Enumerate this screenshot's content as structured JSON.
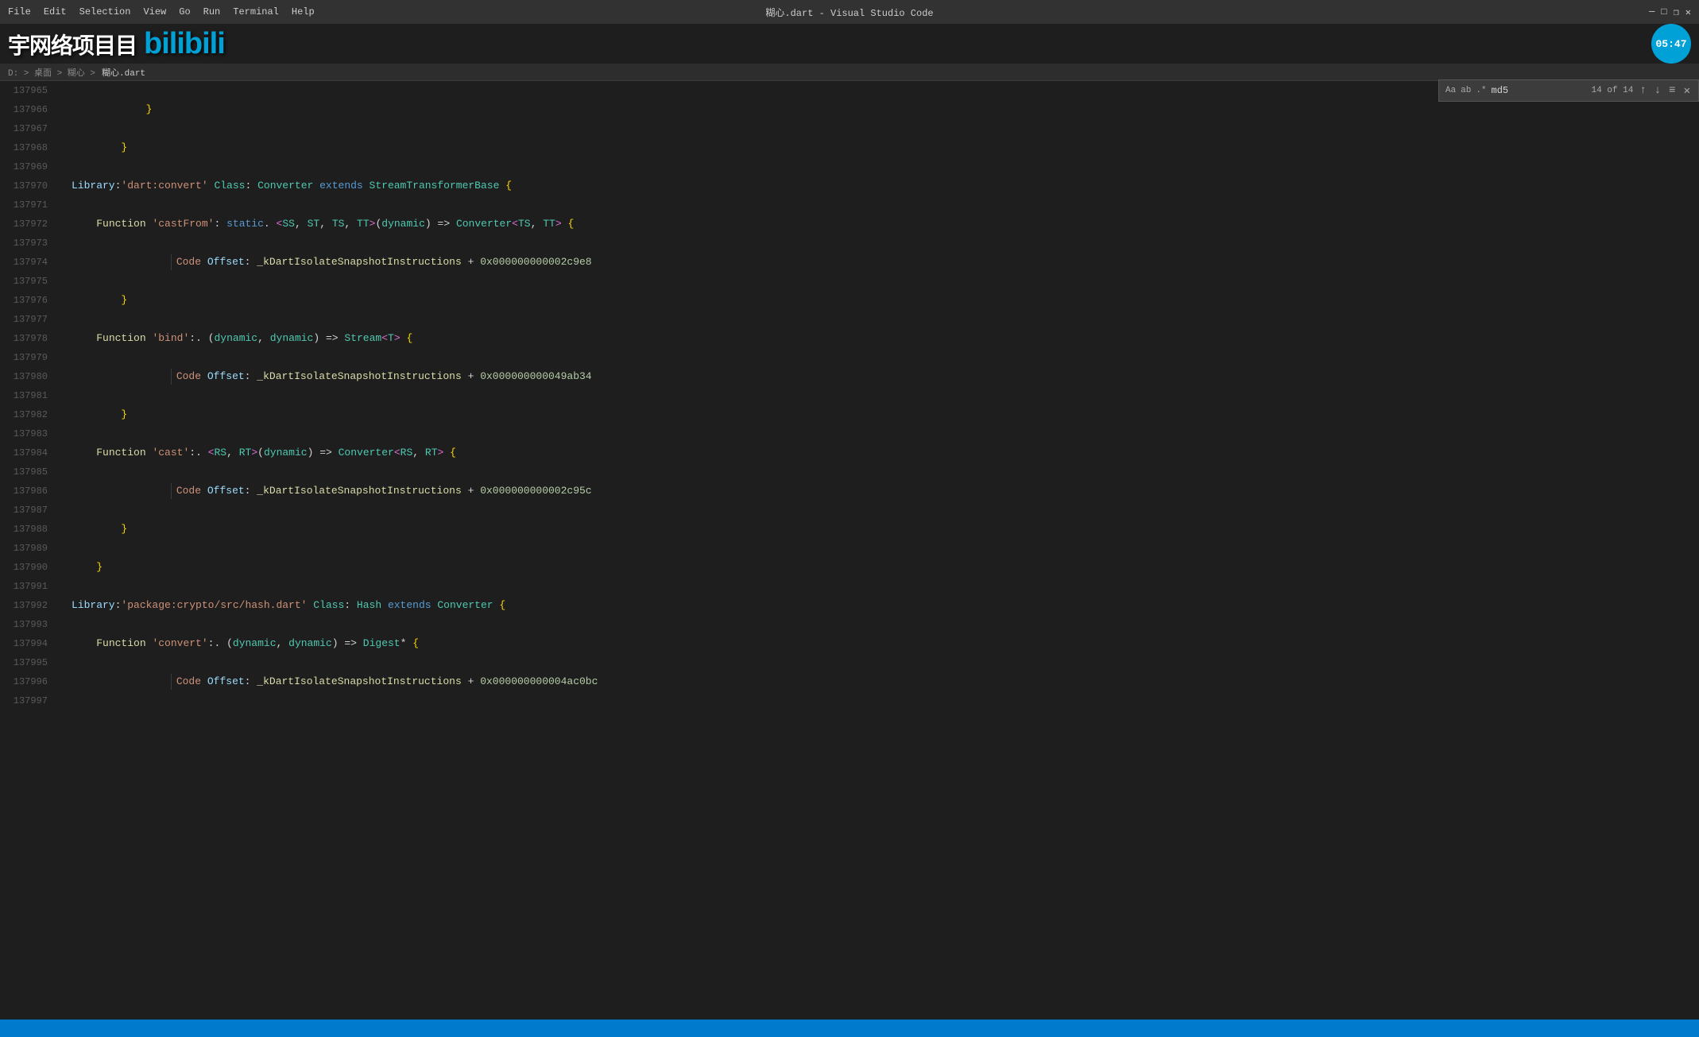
{
  "titlebar": {
    "menu": [
      "File",
      "Edit",
      "Selection",
      "View",
      "Go",
      "Run",
      "Terminal",
      "Help"
    ],
    "title": "糊心.dart - Visual Studio Code"
  },
  "watermark": {
    "prefix": "宇网络项目",
    "bilibili": "bilibili"
  },
  "breadcrumb": {
    "path": "D: > 桌面 > 糊心 > ",
    "file": "糊心.dart"
  },
  "search": {
    "query": "md5",
    "count": "14 of 14",
    "placeholder": "md5"
  },
  "avatar": {
    "time": "05:47"
  },
  "lines": [
    {
      "num": "137965",
      "content": ""
    },
    {
      "num": "137966",
      "content": "            }"
    },
    {
      "num": "137967",
      "content": ""
    },
    {
      "num": "137968",
      "content": "        }"
    },
    {
      "num": "137969",
      "content": ""
    },
    {
      "num": "137970",
      "content": "Library:'dart:convert' Class: Converter extends StreamTransformerBase {",
      "type": "library-class"
    },
    {
      "num": "137971",
      "content": ""
    },
    {
      "num": "137972",
      "content": "    Function 'castFrom': static. <SS, ST, TS, TT>(dynamic) => Converter<TS, TT> {",
      "type": "function-castFrom"
    },
    {
      "num": "137973",
      "content": ""
    },
    {
      "num": "137974",
      "content": "                Code Offset: _kDartIsolateSnapshotInstructions + 0x000000000002c9e8",
      "type": "code-offset"
    },
    {
      "num": "137975",
      "content": ""
    },
    {
      "num": "137976",
      "content": "        }"
    },
    {
      "num": "137977",
      "content": ""
    },
    {
      "num": "137978",
      "content": "    Function 'bind':. (dynamic, dynamic) => Stream<T> {",
      "type": "function-bind"
    },
    {
      "num": "137979",
      "content": ""
    },
    {
      "num": "137980",
      "content": "                Code Offset: _kDartIsolateSnapshotInstructions + 0x000000000049ab34",
      "type": "code-offset"
    },
    {
      "num": "137981",
      "content": ""
    },
    {
      "num": "137982",
      "content": "        }"
    },
    {
      "num": "137983",
      "content": ""
    },
    {
      "num": "137984",
      "content": "    Function 'cast':. <RS, RT>(dynamic) => Converter<RS, RT> {",
      "type": "function-cast"
    },
    {
      "num": "137985",
      "content": ""
    },
    {
      "num": "137986",
      "content": "                Code Offset: _kDartIsolateSnapshotInstructions + 0x000000000002c95c",
      "type": "code-offset"
    },
    {
      "num": "137987",
      "content": ""
    },
    {
      "num": "137988",
      "content": "        }"
    },
    {
      "num": "137989",
      "content": ""
    },
    {
      "num": "137990",
      "content": "    }"
    },
    {
      "num": "137991",
      "content": ""
    },
    {
      "num": "137992",
      "content": "Library:'package:crypto/src/hash.dart' Class: Hash extends Converter {",
      "type": "library-class2"
    },
    {
      "num": "137993",
      "content": ""
    },
    {
      "num": "137994",
      "content": "    Function 'convert':. (dynamic, dynamic) => Digest* {",
      "type": "function-convert"
    },
    {
      "num": "137995",
      "content": ""
    },
    {
      "num": "137996",
      "content": "                Code Offset: _kDartIsolateSnapshotInstructions + 0x000000000004ac0bc",
      "type": "code-offset"
    },
    {
      "num": "137997",
      "content": ""
    }
  ],
  "statusbar": {
    "text": ""
  }
}
